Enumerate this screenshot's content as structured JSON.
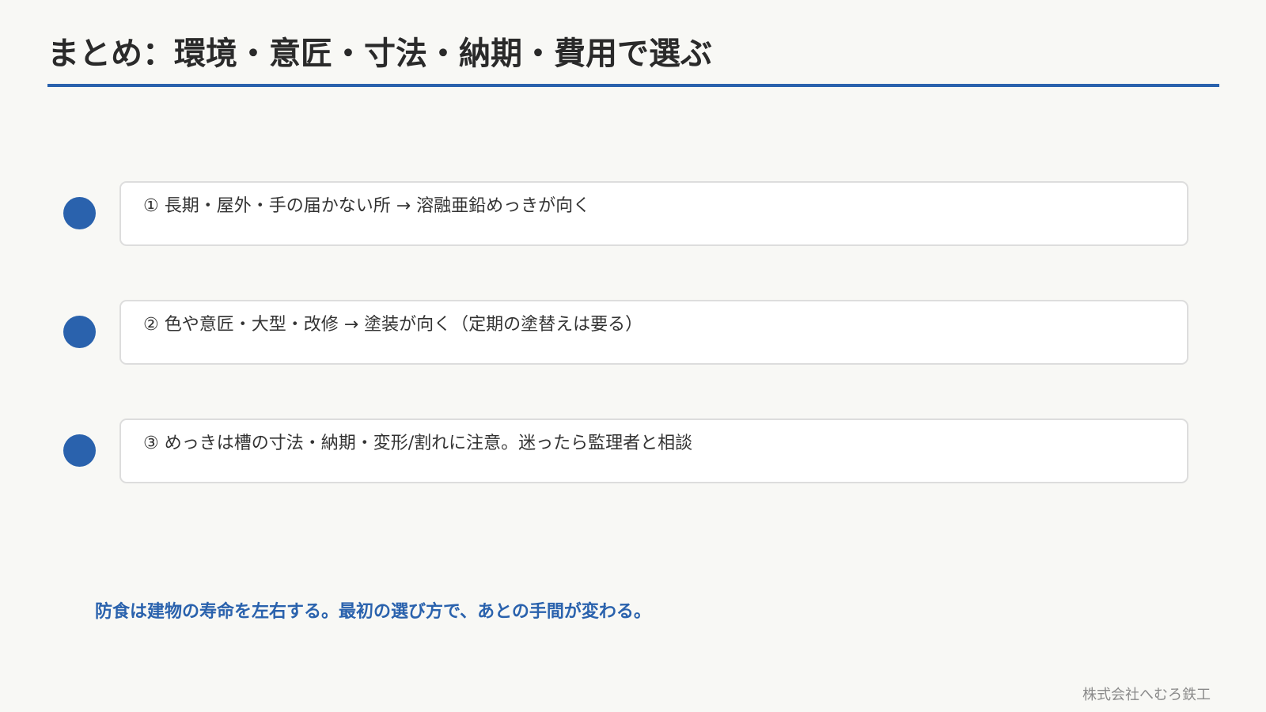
{
  "slide": {
    "title": "まとめ：環境・意匠・寸法・納期・費用で選ぶ",
    "points": [
      {
        "text": "① 長期・屋外・手の届かない所 → 溶融亜鉛めっきが向く"
      },
      {
        "text": "② 色や意匠・大型・改修 → 塗装が向く（定期の塗替えは要る）"
      },
      {
        "text": "③ めっきは槽の寸法・納期・変形/割れに注意。迷ったら監理者と相談"
      }
    ],
    "takeaway": "防食は建物の寿命を左右する。最初の選び方で、あとの手間が変わる。",
    "company": "株式会社へむろ鉄工"
  },
  "colors": {
    "accent": "#2a62ad",
    "background": "#f8f8f5",
    "card_border": "#dddddd",
    "text": "#333333",
    "footer_text": "#8a8a8a"
  }
}
